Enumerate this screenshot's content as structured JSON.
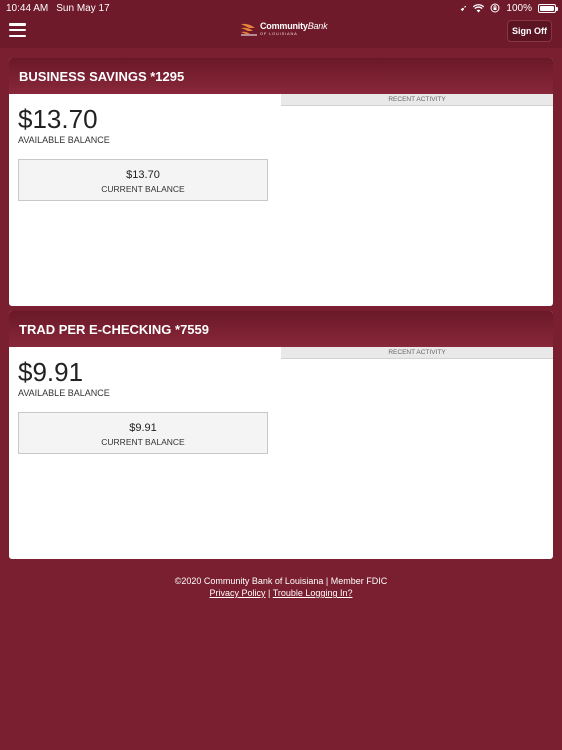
{
  "status_bar": {
    "time": "10:44 AM",
    "date": "Sun May 17",
    "battery_percent": "100%",
    "battery_level": 1.0
  },
  "header": {
    "logo": {
      "name_bold": "Community",
      "name_italic": "Bank",
      "sub": "OF LOUISIANA"
    },
    "signoff_label": "Sign Off"
  },
  "accounts": [
    {
      "title": "BUSINESS SAVINGS *1295",
      "available_balance": "$13.70",
      "available_label": "AVAILABLE BALANCE",
      "current_balance": "$13.70",
      "current_label": "CURRENT BALANCE",
      "recent_activity_label": "RECENT ACTIVITY"
    },
    {
      "title": "TRAD PER E-CHECKING *7559",
      "available_balance": "$9.91",
      "available_label": "AVAILABLE BALANCE",
      "current_balance": "$9.91",
      "current_label": "CURRENT BALANCE",
      "recent_activity_label": "RECENT ACTIVITY"
    }
  ],
  "footer": {
    "copyright": "©2020 Community Bank of Louisiana | Member FDIC",
    "privacy_link": "Privacy Policy",
    "separator": "|",
    "trouble_link": "Trouble Logging In?"
  },
  "colors": {
    "brand_maroon": "#7a1f30",
    "header_maroon": "#6e1a2a",
    "logo_orange": "#e8833a"
  }
}
